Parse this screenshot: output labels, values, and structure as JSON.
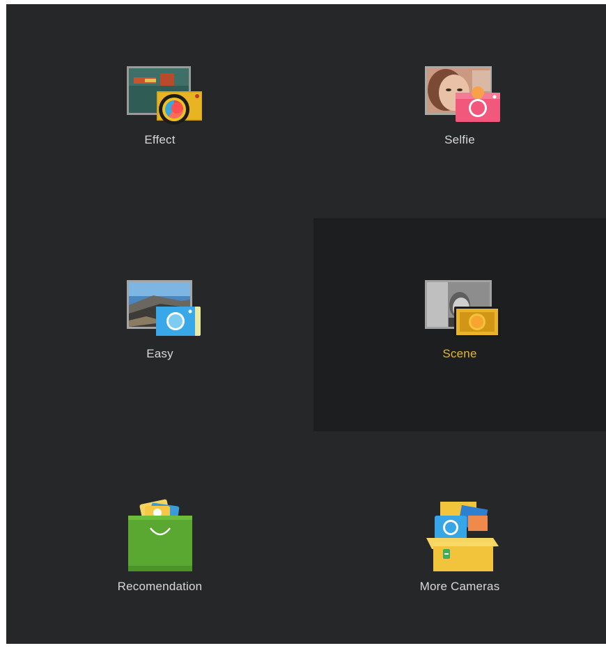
{
  "modes": [
    {
      "id": "effect",
      "label": "Effect",
      "icon": "effect-camera-icon",
      "selected": false
    },
    {
      "id": "selfie",
      "label": "Selfie",
      "icon": "selfie-camera-icon",
      "selected": false
    },
    {
      "id": "easy",
      "label": "Easy",
      "icon": "easy-camera-icon",
      "selected": false
    },
    {
      "id": "scene",
      "label": "Scene",
      "icon": "scene-camera-icon",
      "selected": true
    },
    {
      "id": "recommendation",
      "label": "Recomendation",
      "icon": "shopping-bag-icon",
      "selected": false
    },
    {
      "id": "more_cameras",
      "label": "More Cameras",
      "icon": "camera-box-icon",
      "selected": false
    }
  ],
  "colors": {
    "background": "#262729",
    "selected_background": "#1d1e20",
    "label": "#d8d8d8",
    "selected_label": "#e2b637"
  }
}
